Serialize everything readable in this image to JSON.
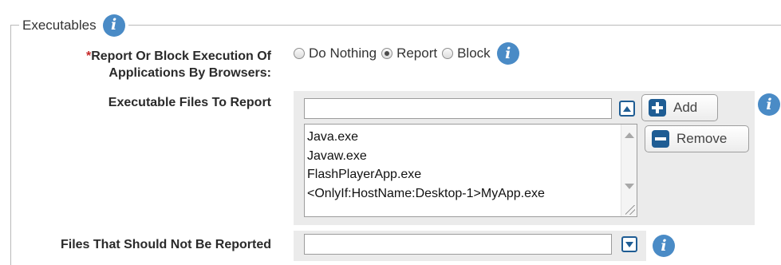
{
  "section": {
    "legend": "Executables",
    "legend_icon": "info-icon"
  },
  "report_or_block": {
    "required_mark": "*",
    "label_line1": "Report Or Block Execution Of",
    "label_line2": "Applications By Browsers:",
    "options": [
      {
        "label": "Do Nothing",
        "checked": false
      },
      {
        "label": "Report",
        "checked": true
      },
      {
        "label": "Block",
        "checked": false
      }
    ],
    "info_icon": "info-icon"
  },
  "files_to_report": {
    "label": "Executable Files To Report",
    "input_value": "",
    "add_label": "Add",
    "remove_label": "Remove",
    "items": [
      "Java.exe",
      "Javaw.exe",
      "FlashPlayerApp.exe",
      "<OnlyIf:HostName:Desktop-1>MyApp.exe"
    ],
    "info_icon": "info-icon"
  },
  "files_not_reported": {
    "label": "Files That Should Not Be Reported",
    "input_value": "",
    "info_icon": "info-icon"
  },
  "colors": {
    "accent": "#1f5d94",
    "info": "#4a8bc6",
    "required": "#c62828",
    "panel": "#ebebeb"
  }
}
